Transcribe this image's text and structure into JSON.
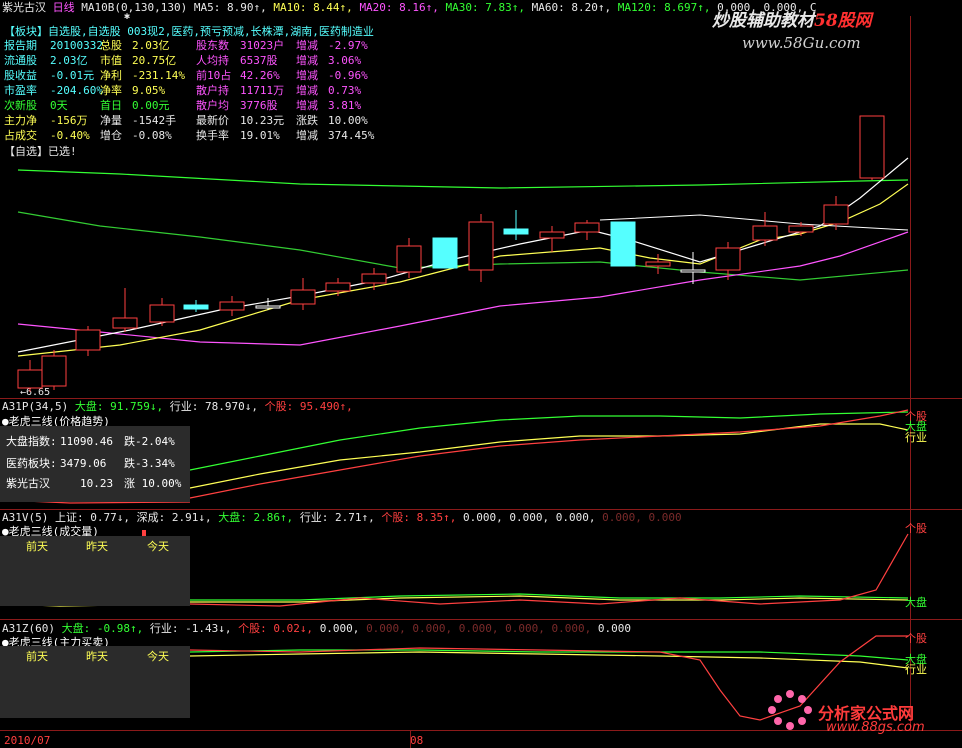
{
  "header": {
    "stock_name": "紫光古汉",
    "period": "日线",
    "ma_params": "MA10B(0,130,130)",
    "ma5": "MA5: 8.90↑,",
    "ma10": "MA10: 8.44↑,",
    "ma20": "MA20: 8.16↑,",
    "ma30": "MA30: 7.83↑,",
    "ma60": "MA60: 8.20↑,",
    "ma120": "MA120: 8.697↑,",
    "tail": "0.000, 0.000, C"
  },
  "info": {
    "row1": "【板块】自选股,自选股 003现2,医药,预亏预减,长株潭,湖南,医药制造业",
    "rows": [
      [
        {
          "t": "报告期",
          "c": "c"
        },
        {
          "t": "20100332",
          "c": "c"
        },
        {
          "t": "总股",
          "c": "y"
        },
        {
          "t": "2.03亿",
          "c": "y"
        },
        {
          "t": "股东数",
          "c": "m"
        },
        {
          "t": "31023户",
          "c": "m"
        },
        {
          "t": "增减",
          "c": "m"
        },
        {
          "t": "-2.97%",
          "c": "m"
        }
      ],
      [
        {
          "t": "流通股",
          "c": "c"
        },
        {
          "t": "2.03亿",
          "c": "c"
        },
        {
          "t": "市值",
          "c": "y"
        },
        {
          "t": "20.75亿",
          "c": "y"
        },
        {
          "t": "人均持",
          "c": "m"
        },
        {
          "t": "6537股",
          "c": "m"
        },
        {
          "t": "增减",
          "c": "m"
        },
        {
          "t": "3.06%",
          "c": "m"
        }
      ],
      [
        {
          "t": "股收益",
          "c": "c"
        },
        {
          "t": "-0.01元",
          "c": "c"
        },
        {
          "t": "净利",
          "c": "y"
        },
        {
          "t": "-231.14%",
          "c": "y"
        },
        {
          "t": "前10占",
          "c": "m"
        },
        {
          "t": "42.26%",
          "c": "m"
        },
        {
          "t": "增减",
          "c": "m"
        },
        {
          "t": "-0.96%",
          "c": "m"
        }
      ],
      [
        {
          "t": "市盈率",
          "c": "c"
        },
        {
          "t": "-204.60%",
          "c": "c"
        },
        {
          "t": "净率",
          "c": "y"
        },
        {
          "t": "9.05%",
          "c": "y"
        },
        {
          "t": "散户持",
          "c": "m"
        },
        {
          "t": "11711万",
          "c": "m"
        },
        {
          "t": "增减",
          "c": "m"
        },
        {
          "t": "0.73%",
          "c": "m"
        }
      ],
      [
        {
          "t": "次新股",
          "c": "g"
        },
        {
          "t": "0天",
          "c": "g"
        },
        {
          "t": "首日",
          "c": "g"
        },
        {
          "t": "0.00元",
          "c": "g"
        },
        {
          "t": "散户均",
          "c": "m"
        },
        {
          "t": "3776股",
          "c": "m"
        },
        {
          "t": "增减",
          "c": "m"
        },
        {
          "t": "3.81%",
          "c": "m"
        }
      ],
      [
        {
          "t": "主力净",
          "c": "y"
        },
        {
          "t": "-156万",
          "c": "y"
        },
        {
          "t": "净量",
          "c": "w"
        },
        {
          "t": "-1542手",
          "c": "w"
        },
        {
          "t": "最新价",
          "c": "w"
        },
        {
          "t": "10.23元",
          "c": "w"
        },
        {
          "t": "涨跌",
          "c": "w"
        },
        {
          "t": "10.00%",
          "c": "w"
        }
      ],
      [
        {
          "t": "占成交",
          "c": "y"
        },
        {
          "t": "-0.40%",
          "c": "y"
        },
        {
          "t": "增仓",
          "c": "w"
        },
        {
          "t": "-0.08%",
          "c": "w"
        },
        {
          "t": "换手率",
          "c": "w"
        },
        {
          "t": "19.01%",
          "c": "w"
        },
        {
          "t": "增减",
          "c": "w"
        },
        {
          "t": "374.45%",
          "c": "w"
        }
      ]
    ],
    "selected": "【自选】已选!",
    "low_price": "←6.65"
  },
  "panel1": {
    "label": "A31P(34,5)",
    "dapan": "大盘: 91.759↓,",
    "hangye": "行业: 78.970↓,",
    "gegu": "个股: 95.490↑,",
    "title": "●老虎三线(价格趋势)",
    "box": [
      [
        "大盘指数:",
        "11090.46",
        "跌-2.04%"
      ],
      [
        "医药板块:",
        "3479.06",
        "跌-3.34%"
      ],
      [
        "紫光古汉",
        "10.23",
        "涨 10.00%"
      ]
    ],
    "legend_gegu": "个股",
    "legend_dapan": "大盘",
    "legend_hangye": "行业"
  },
  "panel2": {
    "label": "A31V(5)",
    "shangzheng": "上证: 0.77↓,",
    "shencheng": "深成: 2.91↓,",
    "dapan": "大盘: 2.86↑,",
    "hangye": "行业: 2.71↑,",
    "gegu": "个股: 8.35↑,",
    "tail": "0.000, 0.000, 0.000,",
    "tail_dim": "0.000, 0.000",
    "title": "●老虎三线(成交量)",
    "cols": [
      "前天",
      "昨天",
      "今天"
    ],
    "legend_gegu": "个股",
    "legend_dapan": "大盘"
  },
  "panel3": {
    "label": "A31Z(60)",
    "dapan": "大盘: -0.98↑,",
    "hangye": "行业: -1.43↓,",
    "gegu": "个股: 0.02↓,",
    "tail": "0.000,",
    "tail_dim": "0.000, 0.000, 0.000, 0.000, 0.000,",
    "tail2": "0.000",
    "title": "●老虎三线(主力买卖)",
    "cols": [
      "前天",
      "昨天",
      "今天"
    ],
    "legend_gegu": "个股",
    "legend_dapan": "大盘",
    "legend_hangye": "行业"
  },
  "footer": {
    "date1": "2010/07",
    "date2": "08"
  },
  "watermark": {
    "top1a": "炒股辅助教材",
    "top1b": "58股网",
    "top2": "www.58Gu.com",
    "bottom1": "分析家公式网",
    "bottom2": "www.88gs.com"
  },
  "colors": {
    "up": "#ff4040",
    "down": "#55ffff",
    "ma5": "#ffffff",
    "ma10": "#ffff55",
    "ma20": "#ff55ff",
    "ma30": "#33ff33",
    "ma60": "#33cc33",
    "ma120": "#ffffff"
  }
}
